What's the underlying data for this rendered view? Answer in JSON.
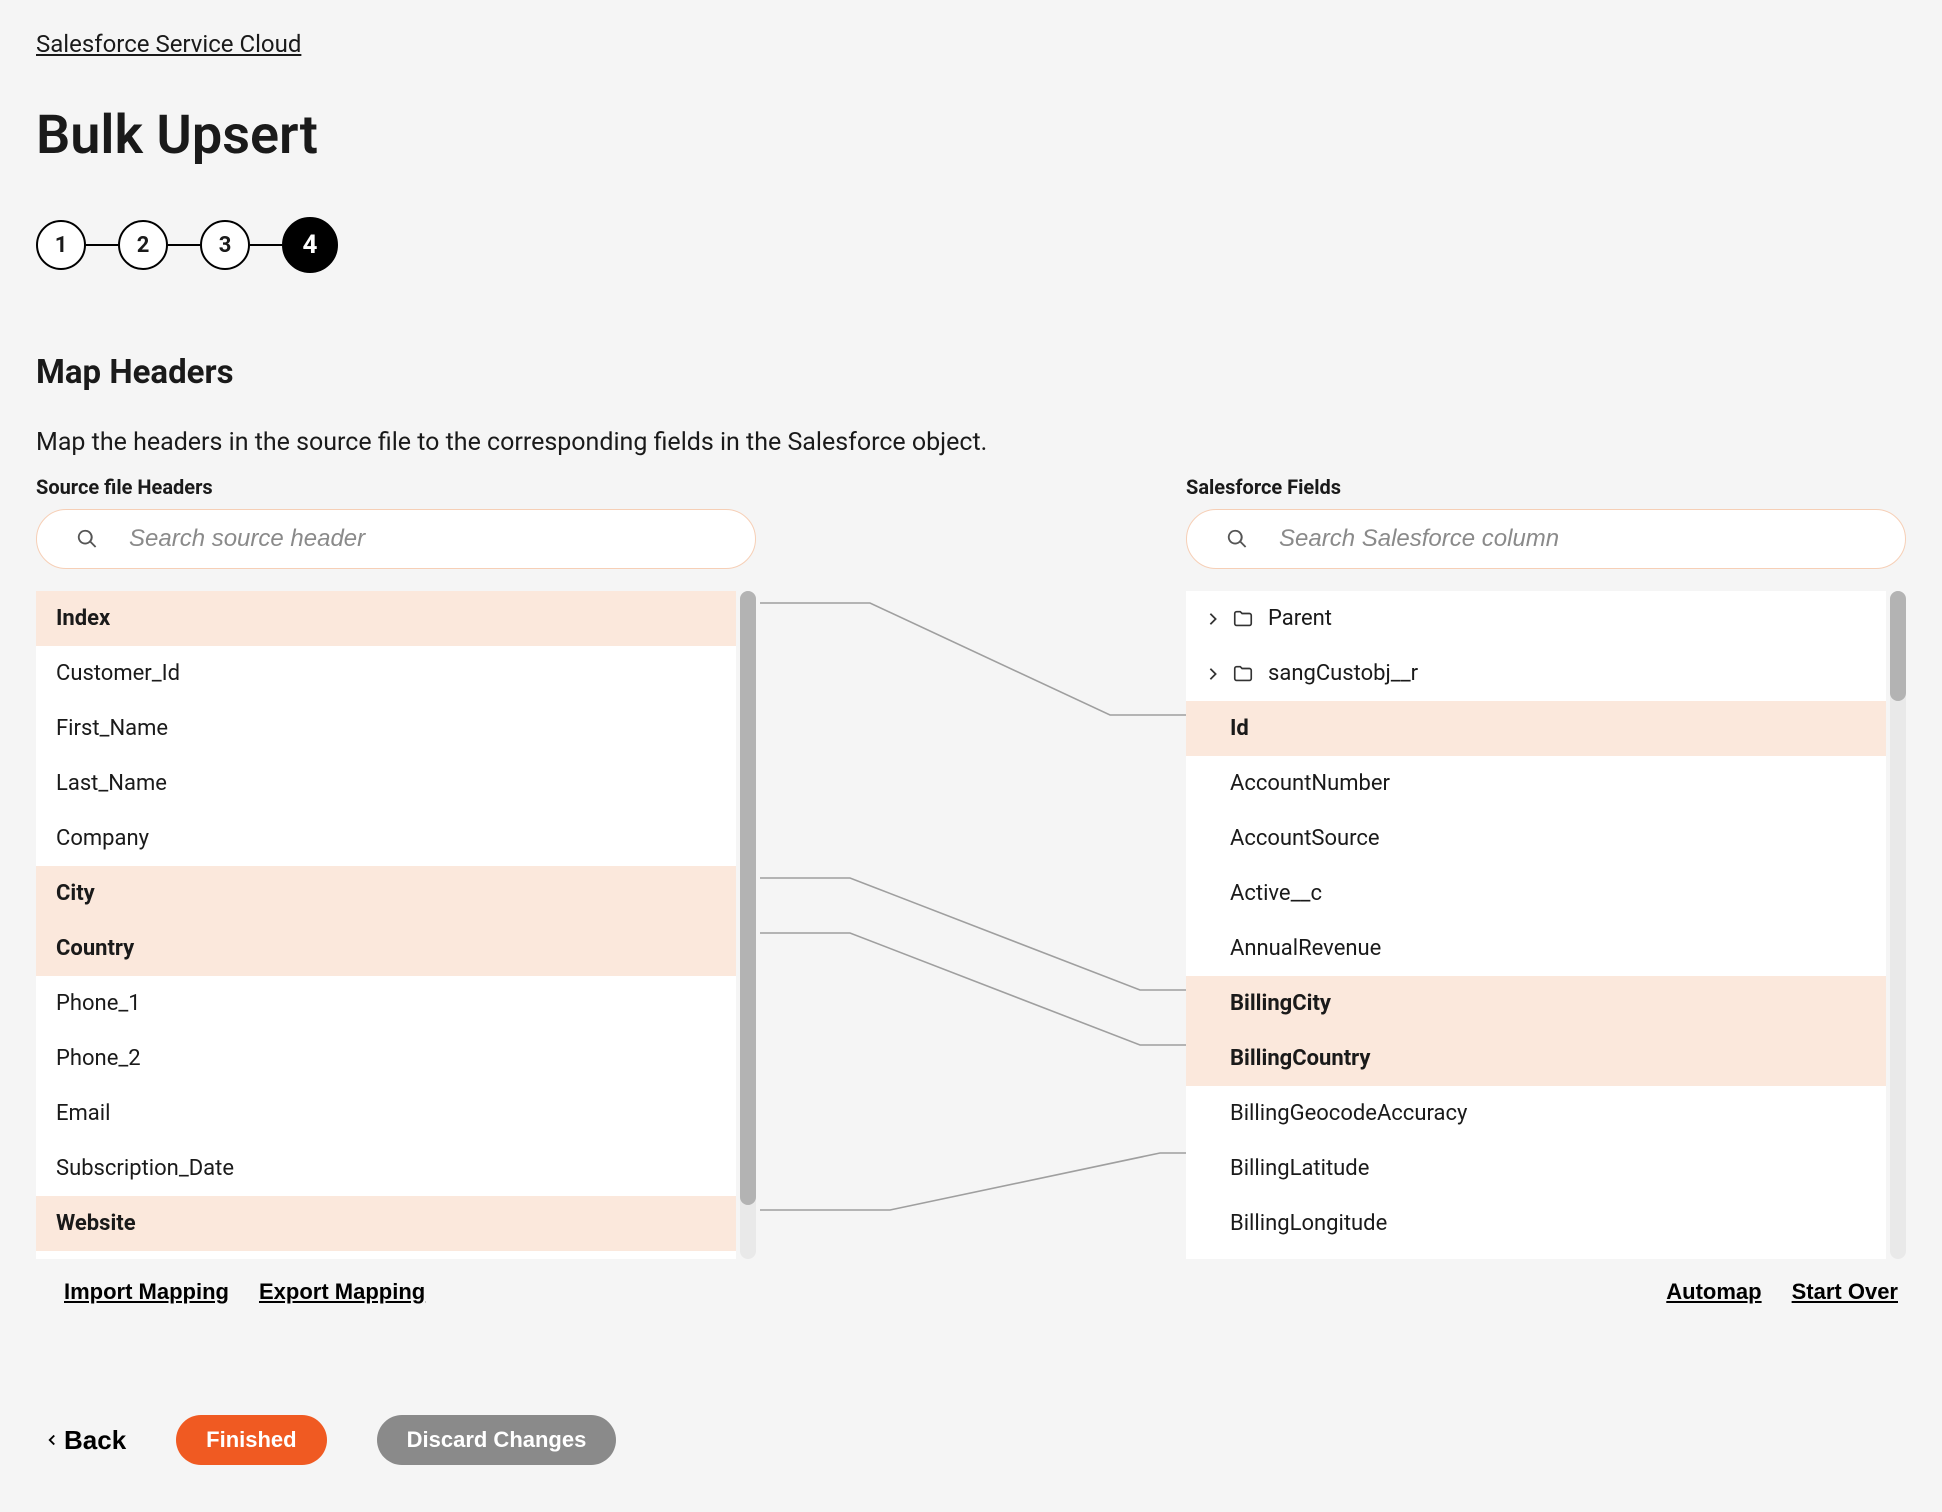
{
  "breadcrumb": "Salesforce Service Cloud",
  "page_title": "Bulk Upsert",
  "stepper": {
    "steps": [
      "1",
      "2",
      "3",
      "4"
    ],
    "active": 4
  },
  "section": {
    "title": "Map Headers",
    "description": "Map the headers in the source file to the corresponding fields in the Salesforce object."
  },
  "source": {
    "label": "Source file Headers",
    "search_placeholder": "Search source header",
    "items": [
      {
        "name": "Index",
        "mapped": true
      },
      {
        "name": "Customer_Id",
        "mapped": false
      },
      {
        "name": "First_Name",
        "mapped": false
      },
      {
        "name": "Last_Name",
        "mapped": false
      },
      {
        "name": "Company",
        "mapped": false
      },
      {
        "name": "City",
        "mapped": true
      },
      {
        "name": "Country",
        "mapped": true
      },
      {
        "name": "Phone_1",
        "mapped": false
      },
      {
        "name": "Phone_2",
        "mapped": false
      },
      {
        "name": "Email",
        "mapped": false
      },
      {
        "name": "Subscription_Date",
        "mapped": false
      },
      {
        "name": "Website",
        "mapped": true
      }
    ]
  },
  "salesforce": {
    "label": "Salesforce Fields",
    "search_placeholder": "Search Salesforce column",
    "items": [
      {
        "name": "Parent",
        "folder": true,
        "mapped": false
      },
      {
        "name": "sangCustobj__r",
        "folder": true,
        "mapped": false
      },
      {
        "name": "Id",
        "folder": false,
        "mapped": true
      },
      {
        "name": "AccountNumber",
        "folder": false,
        "mapped": false
      },
      {
        "name": "AccountSource",
        "folder": false,
        "mapped": false
      },
      {
        "name": "Active__c",
        "folder": false,
        "mapped": false
      },
      {
        "name": "AnnualRevenue",
        "folder": false,
        "mapped": false
      },
      {
        "name": "BillingCity",
        "folder": false,
        "mapped": true
      },
      {
        "name": "BillingCountry",
        "folder": false,
        "mapped": true
      },
      {
        "name": "BillingGeocodeAccuracy",
        "folder": false,
        "mapped": false
      },
      {
        "name": "BillingLatitude",
        "folder": false,
        "mapped": false
      },
      {
        "name": "BillingLongitude",
        "folder": false,
        "mapped": false
      }
    ]
  },
  "actions": {
    "import_mapping": "Import Mapping",
    "export_mapping": "Export Mapping",
    "automap": "Automap",
    "start_over": "Start Over"
  },
  "footer": {
    "back": "Back",
    "finished": "Finished",
    "discard": "Discard Changes"
  }
}
